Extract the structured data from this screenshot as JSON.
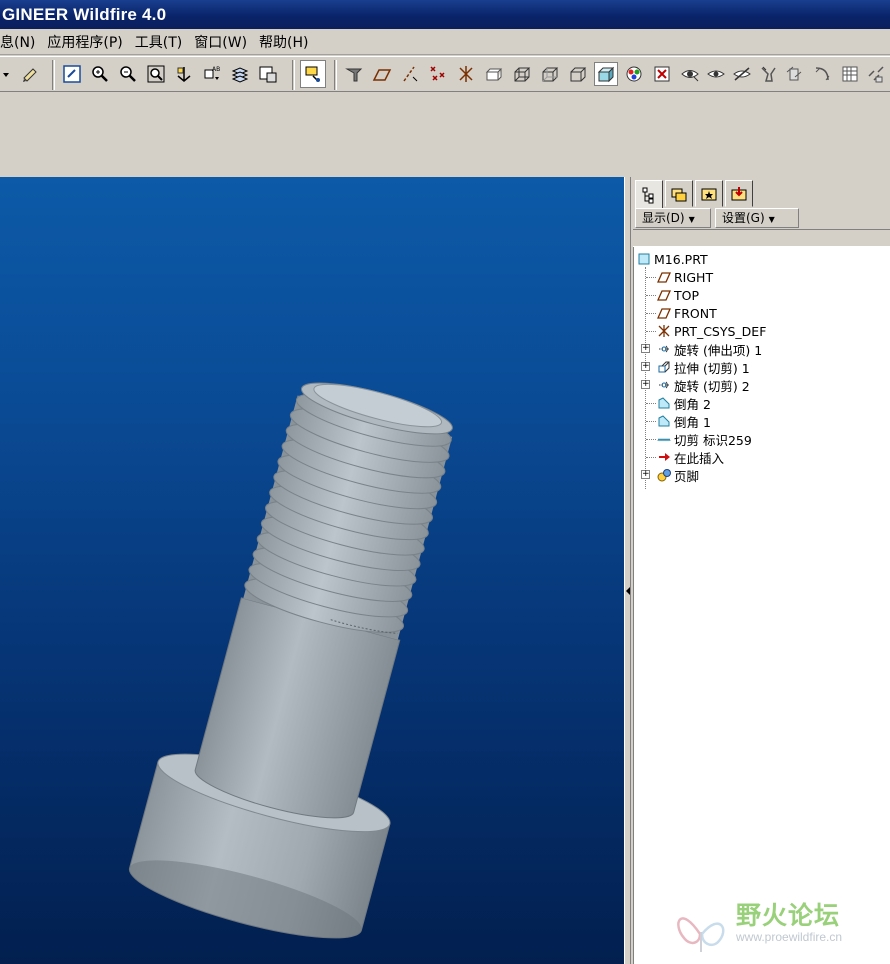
{
  "window": {
    "title": "GINEER Wildfire 4.0"
  },
  "menubar": {
    "items": [
      {
        "label": "息(N)"
      },
      {
        "label": "应用程序(P)"
      },
      {
        "label": "工具(T)"
      },
      {
        "label": "窗口(W)"
      },
      {
        "label": "帮助(H)"
      }
    ]
  },
  "toolbar": {
    "icons": [
      "dropdown-arrow-icon",
      "regenerate-icon",
      "repaint-icon",
      "zoom-in-icon",
      "zoom-out-icon",
      "refit-icon",
      "reorient-icon",
      "saved-views-icon",
      "layers-icon",
      "view-manager-icon",
      "spin-center-icon",
      "datum-axis-display-icon",
      "datum-plane-display-icon",
      "datum-axis-icon",
      "datum-point-icon",
      "csys-display-icon",
      "annotation-icon",
      "wireframe-icon",
      "hidden-line-icon",
      "no-hidden-icon",
      "shading-icon",
      "enhanced-realism-icon",
      "appearance-icon",
      "close-window-icon",
      "show-icon",
      "hide-icon",
      "unhide-icon",
      "model-tree-icon",
      "sketch-icon",
      "analysis-icon",
      "table-icon",
      "pattern-icon"
    ]
  },
  "viewport": {
    "model_name": "M16 socket head cap screw",
    "background_top": "#0c5aa8",
    "background_bottom": "#021f4f",
    "model_color": "#a8b0b8"
  },
  "navigator": {
    "tabs": [
      "model-tree-tab",
      "folder-browser-tab",
      "favorites-tab",
      "connections-tab"
    ],
    "show_button": "显示(D)",
    "settings_button": "设置(G)",
    "tree": [
      {
        "label": "M16.PRT",
        "icon": "part-icon",
        "expandable": false
      },
      {
        "label": "RIGHT",
        "icon": "datum-plane-icon",
        "expandable": false
      },
      {
        "label": "TOP",
        "icon": "datum-plane-icon",
        "expandable": false
      },
      {
        "label": "FRONT",
        "icon": "datum-plane-icon",
        "expandable": false
      },
      {
        "label": "PRT_CSYS_DEF",
        "icon": "csys-icon",
        "expandable": false
      },
      {
        "label": "旋转 (伸出项) 1",
        "icon": "revolve-icon",
        "expandable": true
      },
      {
        "label": "拉伸 (切剪) 1",
        "icon": "extrude-icon",
        "expandable": true
      },
      {
        "label": "旋转 (切剪) 2",
        "icon": "revolve-icon",
        "expandable": true
      },
      {
        "label": "倒角 2",
        "icon": "chamfer-icon",
        "expandable": false
      },
      {
        "label": "倒角 1",
        "icon": "chamfer-icon",
        "expandable": false
      },
      {
        "label": "切剪 标识259",
        "icon": "cosmetic-thread-icon",
        "expandable": false
      },
      {
        "label": "在此插入",
        "icon": "insert-here-icon",
        "expandable": false
      },
      {
        "label": "页脚",
        "icon": "footer-icon",
        "expandable": true
      }
    ]
  },
  "watermark": {
    "text": "野火论坛",
    "url": "www.proewildfire.cn"
  }
}
